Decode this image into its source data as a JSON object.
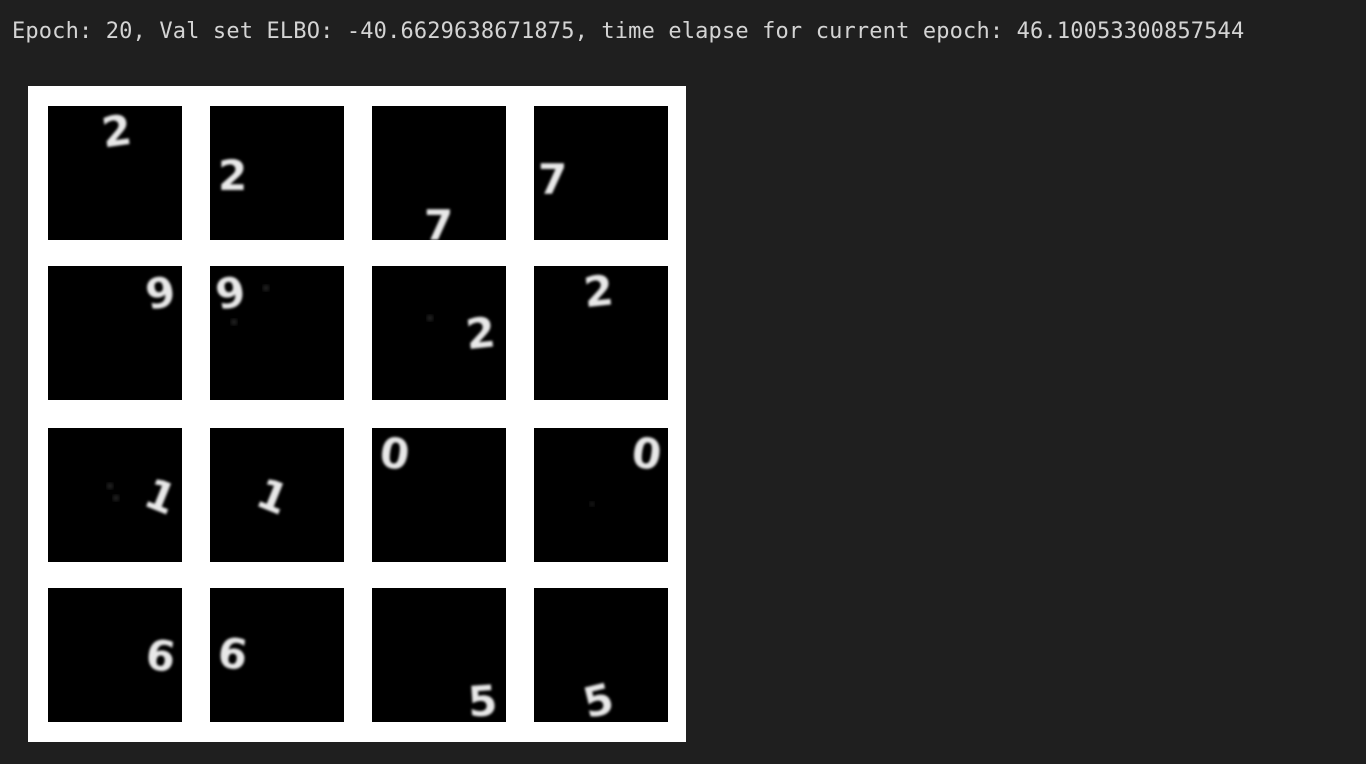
{
  "output": {
    "text": "Epoch: 20, Val set ELBO: -40.6629638671875, time elapse for current epoch: 46.10053300857544"
  },
  "figure": {
    "rows": 4,
    "cols": 4,
    "digits": [
      {
        "label": "2"
      },
      {
        "label": "2"
      },
      {
        "label": "7"
      },
      {
        "label": "7"
      },
      {
        "label": "9"
      },
      {
        "label": "9"
      },
      {
        "label": "2"
      },
      {
        "label": "2"
      },
      {
        "label": "1"
      },
      {
        "label": "1"
      },
      {
        "label": "0"
      },
      {
        "label": "0"
      },
      {
        "label": "6"
      },
      {
        "label": "6"
      },
      {
        "label": "5"
      },
      {
        "label": "5"
      }
    ]
  },
  "colors": {
    "background": "#1f1f1f",
    "text": "#d4d4d4",
    "figure_bg": "#ffffff",
    "cell_bg": "#000000",
    "digit": "#e8e8e8"
  }
}
